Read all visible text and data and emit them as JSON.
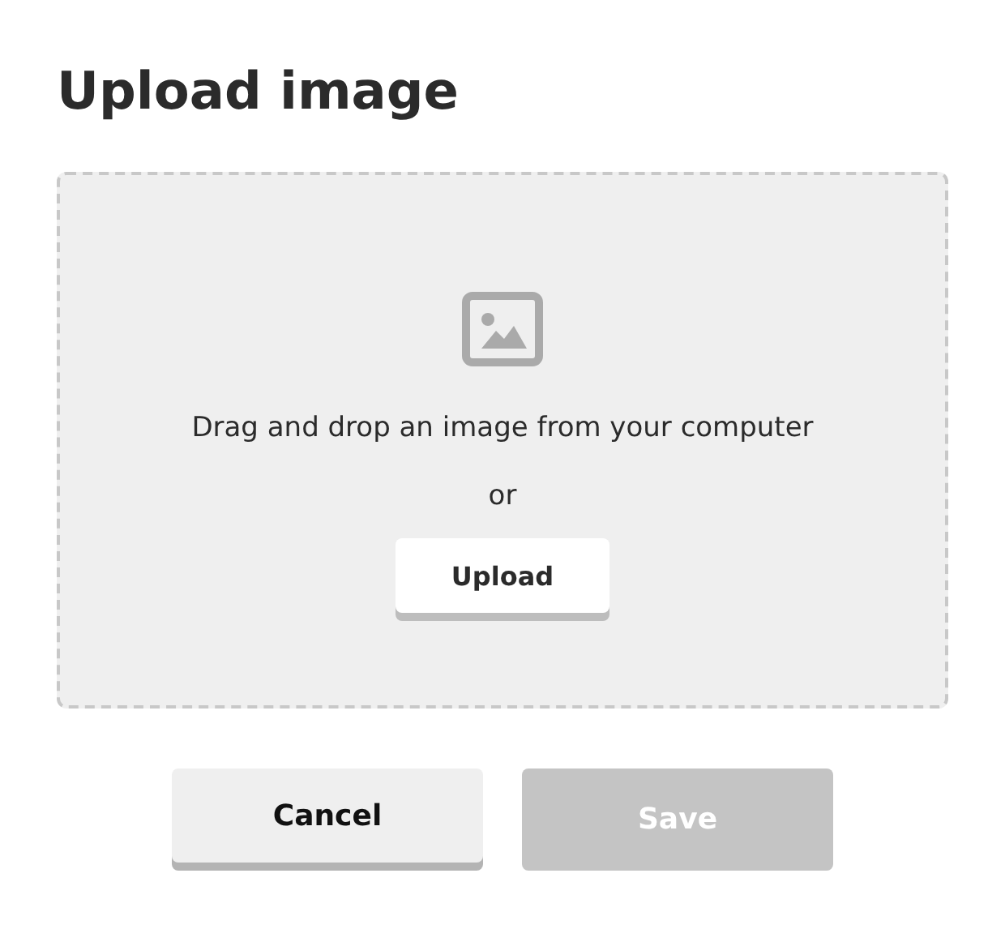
{
  "title": "Upload image",
  "dropzone": {
    "message": "Drag and drop an image from your computer",
    "separator": "or",
    "upload_button": "Upload"
  },
  "buttons": [
    {
      "label": "Cancel",
      "disabled": false
    },
    {
      "label": "Save",
      "disabled": true
    }
  ]
}
